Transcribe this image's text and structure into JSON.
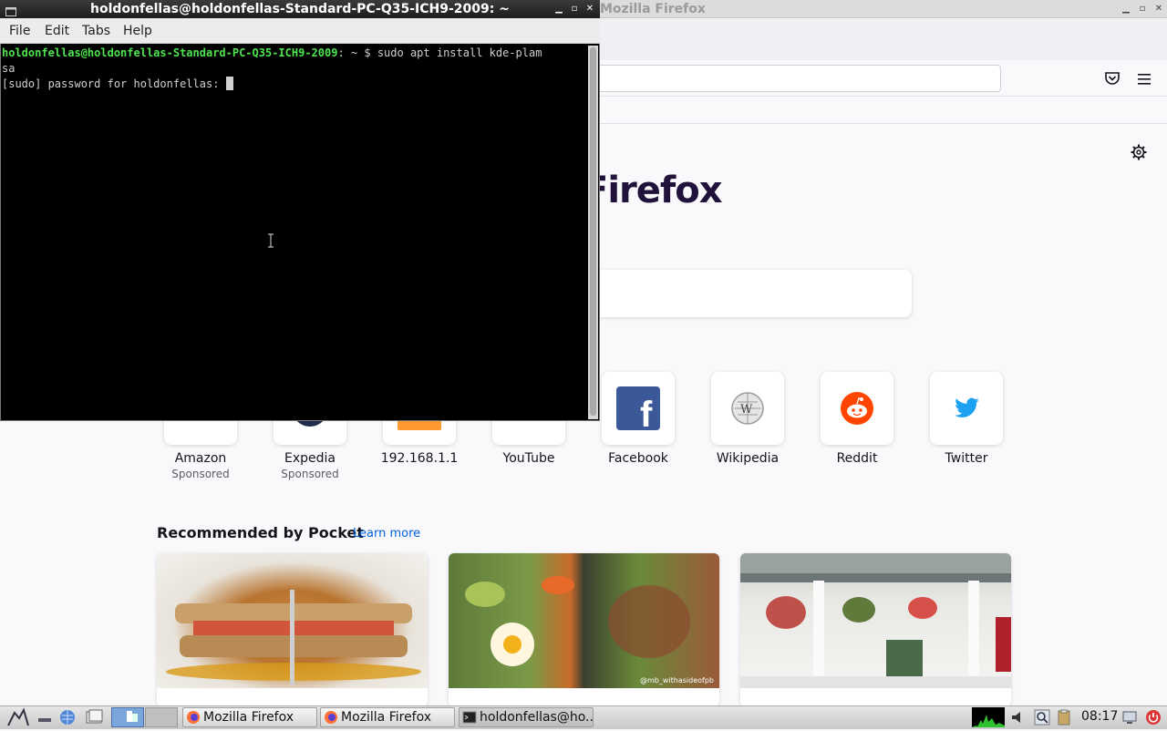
{
  "firefox": {
    "window_title": "Mozilla Firefox",
    "brand_text": "Firefox",
    "shortcuts": [
      {
        "label": "Amazon",
        "sub": "Sponsored"
      },
      {
        "label": "Expedia",
        "sub": "Sponsored"
      },
      {
        "label": "192.168.1.1",
        "sub": ""
      },
      {
        "label": "YouTube",
        "sub": ""
      },
      {
        "label": "Facebook",
        "sub": ""
      },
      {
        "label": "Wikipedia",
        "sub": ""
      },
      {
        "label": "Reddit",
        "sub": ""
      },
      {
        "label": "Twitter",
        "sub": ""
      }
    ],
    "pocket": {
      "heading": "Recommended by Pocket",
      "learn_more": "Learn more",
      "watermark": "@mb_withasideofpb"
    }
  },
  "terminal": {
    "title": "holdonfellas@holdonfellas-Standard-PC-Q35-ICH9-2009: ~",
    "menu": [
      "File",
      "Edit",
      "Tabs",
      "Help"
    ],
    "prompt_user": "holdonfellas@holdonfellas-Standard-PC-Q35-ICH9-2009",
    "prompt_suffix": ": ~ $ ",
    "command_line1": "sudo apt install kde-plam",
    "command_line2": "sa",
    "password_prompt": "[sudo] password for holdonfellas: "
  },
  "taskbar": {
    "tasks": [
      "Mozilla Firefox",
      "Mozilla Firefox",
      "holdonfellas@ho..."
    ],
    "clock": "08:17"
  },
  "colors": {
    "prompt_green": "#4ee44e",
    "facebook": "#3b5998",
    "reddit": "#ff4500",
    "twitter": "#1da1f2",
    "pocket_link": "#0061e0"
  }
}
